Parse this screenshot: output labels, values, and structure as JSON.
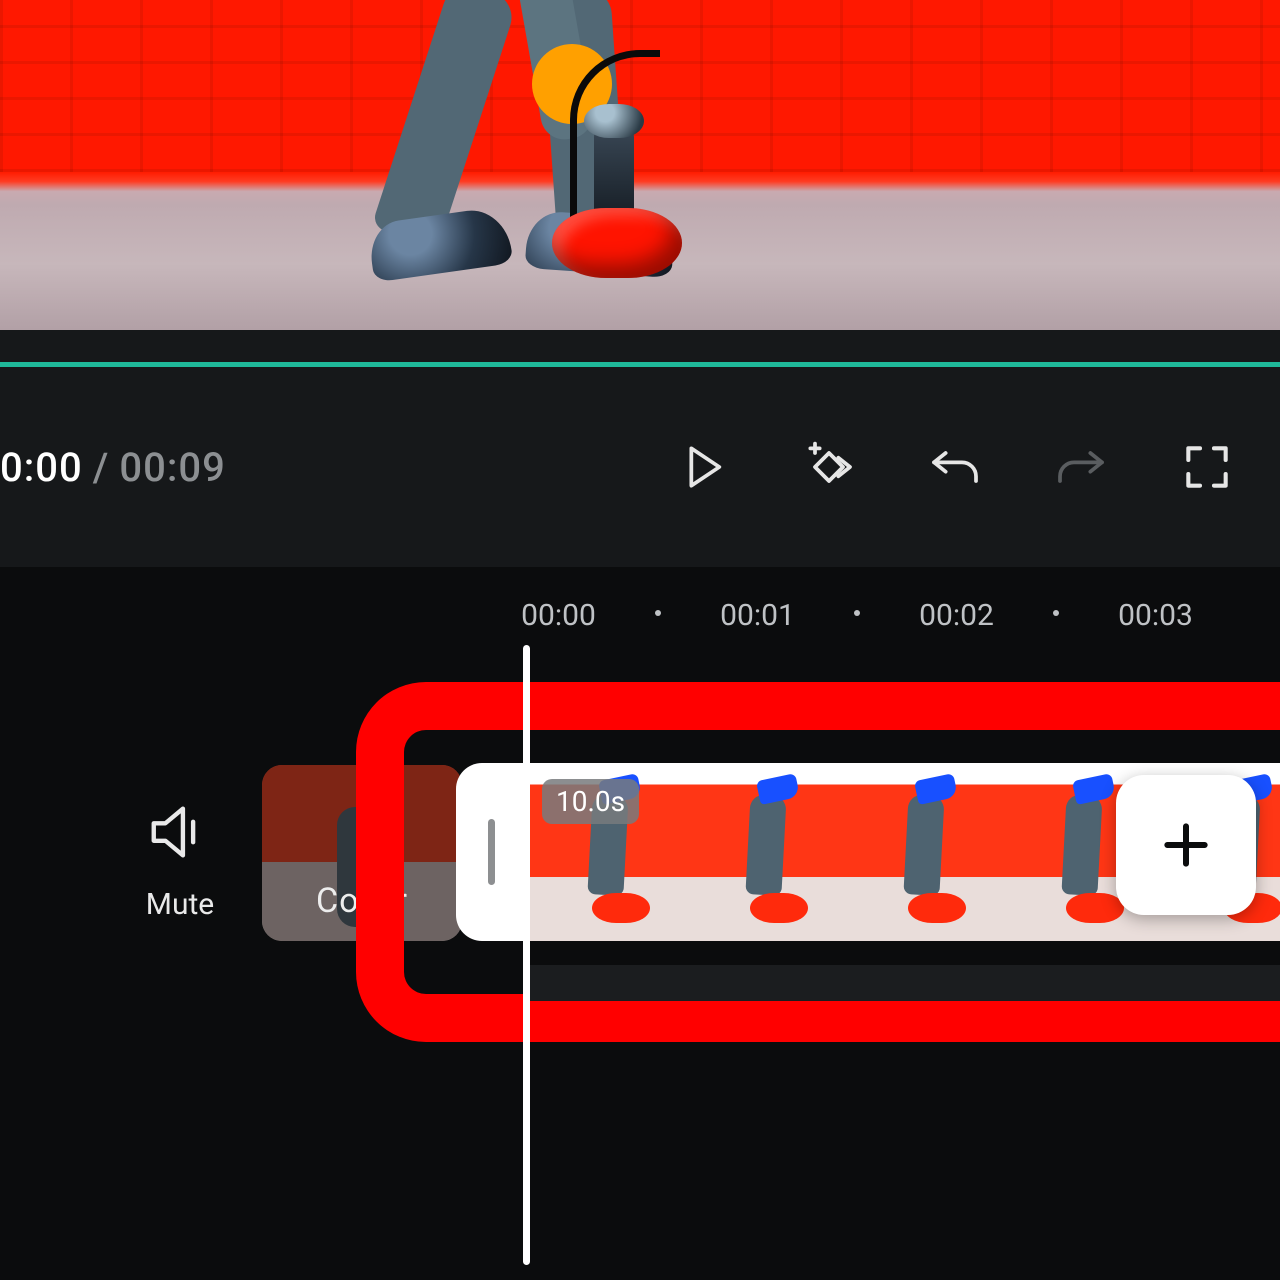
{
  "playback": {
    "current_time": "0:00",
    "separator": "/",
    "duration": "00:09"
  },
  "ruler": {
    "t0": "00:00",
    "t1": "00:01",
    "t2": "00:02",
    "t3": "00:03"
  },
  "mute": {
    "label": "Mute"
  },
  "cover": {
    "label": "Cover"
  },
  "clip": {
    "duration_badge": "10.0s"
  },
  "icons": {
    "play": "play-icon",
    "keyframe": "keyframe-add-icon",
    "undo": "undo-icon",
    "redo": "redo-icon",
    "fullscreen": "fullscreen-icon",
    "speaker": "speaker-icon",
    "plus": "plus-icon"
  },
  "colors": {
    "accent_teal": "#1fb99a",
    "highlight_red": "#ff0000",
    "bg_dark": "#0b0c0d"
  }
}
